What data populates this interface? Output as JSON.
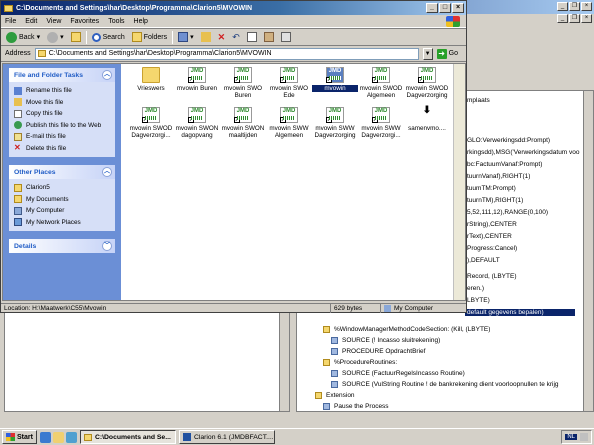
{
  "explorer": {
    "title": "C:\\Documents and Settings\\har\\Desktop\\Programma\\Clarion5\\MVOWIN",
    "menu": [
      "File",
      "Edit",
      "View",
      "Favorites",
      "Tools",
      "Help"
    ],
    "toolbar": {
      "back": "Back",
      "search": "Search",
      "folders": "Folders"
    },
    "address_label": "Address",
    "address_value": "C:\\Documents and Settings\\har\\Desktop\\Programma\\Clarion5\\MVOWIN",
    "go_label": "Go",
    "tasks_header": "File and Folder Tasks",
    "tasks": [
      "Rename this file",
      "Move this file",
      "Copy this file",
      "Publish this file to the Web",
      "E-mail this file",
      "Delete this file"
    ],
    "places_header": "Other Places",
    "places": [
      "Clarion5",
      "My Documents",
      "My Computer",
      "My Network Places"
    ],
    "details_header": "Details",
    "files": [
      {
        "name": "Vrieswers",
        "type": "folder"
      },
      {
        "name": "mvowin Buren",
        "type": "jmd"
      },
      {
        "name": "mvowin SWO Buren",
        "type": "jmd"
      },
      {
        "name": "mvowin SWO Ede",
        "type": "jmd"
      },
      {
        "name": "mvowin",
        "type": "jmd",
        "selected": true
      },
      {
        "name": "mvowin SWOD Algemeen",
        "type": "jmd"
      },
      {
        "name": "mvowin SWOD Dagverzorging",
        "type": "jmd"
      },
      {
        "name": "mvowin SWOD Dagverzorgi...",
        "type": "jmd"
      },
      {
        "name": "mvowin SWON dagopvang",
        "type": "jmd"
      },
      {
        "name": "mvowin SWON maaltijden",
        "type": "jmd"
      },
      {
        "name": "mvowin SWW Algemeen",
        "type": "jmd"
      },
      {
        "name": "mvowin SWW Dagverzorging",
        "type": "jmd"
      },
      {
        "name": "mvowin SWW Dagverzorgi...",
        "type": "jmd"
      },
      {
        "name": "samenvmo....",
        "type": "shortcut"
      }
    ],
    "status_location": "Location: H:\\Maatwerk\\C55\\Mvowin",
    "status_size": "629 bytes",
    "status_zone": "My Computer"
  },
  "clarion": {
    "tree_lines": [
      "mplaats",
      "GLO:Verwerkingsdd:Prompt)",
      "rkingsdd),MSG('Verwerkingsdatum voo",
      "bc:FactuumVanaf:Prompt)",
      "tuurnVanaf),RIGHT(1)",
      "tuumTM:Prompt)",
      "tuurnTM),RIGHT(1)",
      "5,52,111,12),RANGE(0,100)",
      "rString),CENTER",
      "rText),CENTER",
      "Progress:Cancel)",
      "),DEFAULT",
      "Record, (LBYTE)",
      "eren.)",
      "LBYTE)",
      "default gegevens bepalen)"
    ],
    "lower_tree": [
      {
        "text": "%WindowManagerMethodCodeSection: (Kill, (LBYTE)",
        "icon": "folder",
        "indent": 1
      },
      {
        "text": "SOURCE (! Incasso sluitrekening)",
        "icon": "doc",
        "indent": 2
      },
      {
        "text": "PROCEDURE OpdrachtBrief",
        "icon": "doc",
        "indent": 2
      },
      {
        "text": "%ProcedureRoutines:",
        "icon": "folder",
        "indent": 1
      },
      {
        "text": "SOURCE (FactuurRegelsIncasso Routine)",
        "icon": "doc",
        "indent": 2
      },
      {
        "text": "SOURCE (VulString    Routine          ! de bankrekening dient voorloopnullen te krijg",
        "icon": "doc",
        "indent": 2
      },
      {
        "text": "Extension",
        "icon": "folder",
        "indent": 0
      },
      {
        "text": "Pause the Process",
        "icon": "doc",
        "indent": 1
      }
    ]
  },
  "taskbar": {
    "start": "Start",
    "tasks": [
      "C:\\Documents and Se...",
      "Clarion 6.1 (JMDBFACT...."
    ],
    "tray_lang": "NL"
  }
}
